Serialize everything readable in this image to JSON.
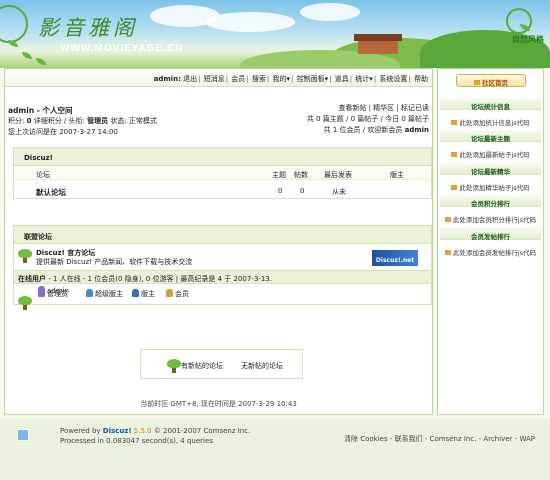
{
  "header": {
    "logo_text": "影音雅阁",
    "site_url": "WWW.MOVIEYAGE.CN",
    "brand_text": "自然风格"
  },
  "userbar": {
    "username": "admin:",
    "links": [
      "退出",
      "短消息",
      "会员",
      "搜索",
      "我的▾",
      "控制面板▾",
      "道具",
      "统计▾",
      "系统设置",
      "帮助"
    ]
  },
  "profile": {
    "title": "admin - 个人空间",
    "line1_prefix": "积分: ",
    "credits": "0",
    "line1_mid": " 详细积分 / 头衔: ",
    "rank": "管理员",
    "line1_suffix": " 状态: 正常模式",
    "last_visit": "您上次访问是在 2007-3-27 14:00"
  },
  "stats_right": {
    "links_line": "查看新帖 | 精华区 | 标记已读",
    "counts_line": "共 0 篇主题 / 0 篇帖子 / 今日 0 篇帖子",
    "members_prefix": "共 1 位会员 / 欢迎新会员 ",
    "new_member": "admin"
  },
  "forum": {
    "category": "Discuz!",
    "columns": {
      "forum": "论坛",
      "topics": "主题",
      "posts": "帖数",
      "last_post": "最后发表",
      "moderator": "版主"
    },
    "rows": [
      {
        "name": "默认论坛",
        "topics": "0",
        "posts": "0",
        "last_post": "从未",
        "moderator": ""
      }
    ]
  },
  "alliance": {
    "title": "联盟论坛",
    "name": "Discuz! 官方论坛",
    "desc": "提供最新 Discuz! 产品新闻、软件下载与技术交流",
    "badge": "Discuz!.net"
  },
  "online": {
    "label": "在线用户",
    "summary": " - 1 人在线 - 1 位会员(0 隐身), 0 位游客 | 最高纪录是 4 于 2007-3-13.",
    "legend": [
      "管理员",
      "超级版主",
      "版主",
      "会员"
    ],
    "users": [
      "admin"
    ]
  },
  "legend_box": {
    "new_posts": "有新帖的论坛",
    "no_new_posts": "无新帖的论坛"
  },
  "timebar": "当前时区 GMT+8, 现在时间是 2007-3-29 10:43",
  "sidebar": {
    "home": "社区首页",
    "sections": [
      {
        "title": "论坛统计信息",
        "text": "此处添加统计信息js代码"
      },
      {
        "title": "论坛最新主题",
        "text": "此处添加最新帖子js代码"
      },
      {
        "title": "论坛最新精华",
        "text": "此处添加精华帖子js代码"
      },
      {
        "title": "会员积分排行",
        "text": "此处添加会员积分排行js代码"
      },
      {
        "title": "会员发帖排行",
        "text": "此处添加会员发帖排行js代码"
      }
    ]
  },
  "footer": {
    "powered_prefix": "Powered by ",
    "product": "Discuz!",
    "version": " 5.5.0",
    "copyright": " © 2001-2007 Comsenz Inc.",
    "processed": "Processed in 0.083047 second(s), 4 queries",
    "links": "清除 Cookies - 联系我们 - Comsenz Inc. - Archiver - WAP"
  },
  "colors": {
    "accent_green": "#6fbf3a",
    "header_bg": "#e8f3d9",
    "link_blue": "#1a56a8",
    "brand_orange": "#e07e00"
  }
}
